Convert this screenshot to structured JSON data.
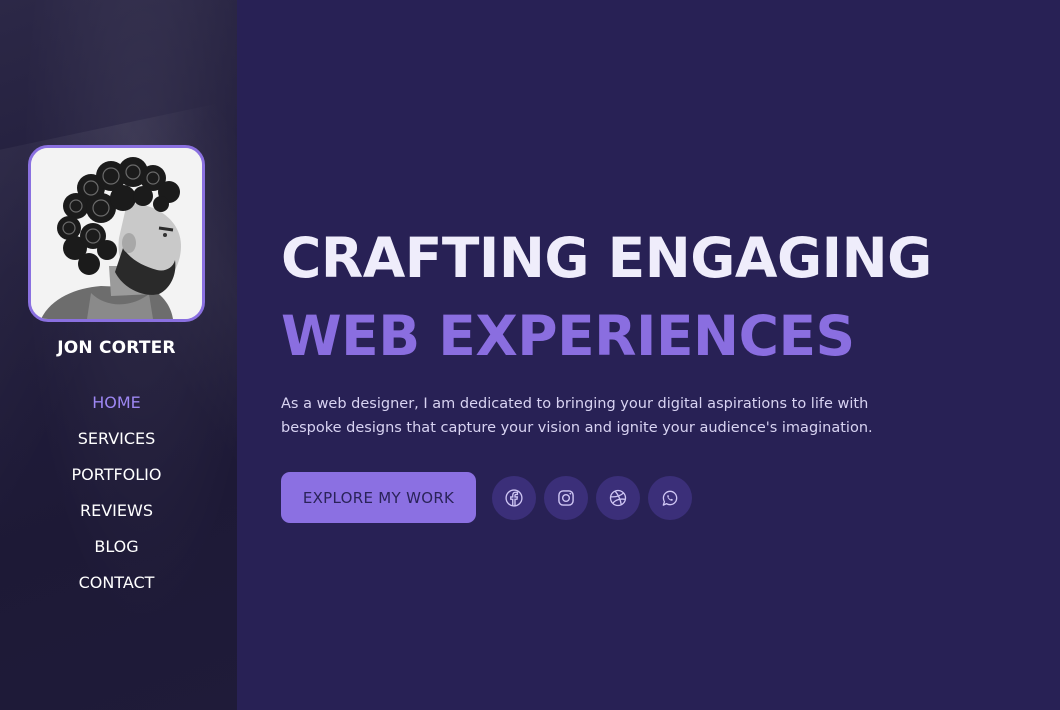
{
  "profile": {
    "name": "JON CORTER"
  },
  "nav": {
    "items": [
      {
        "label": "HOME",
        "active": true
      },
      {
        "label": "SERVICES",
        "active": false
      },
      {
        "label": "PORTFOLIO",
        "active": false
      },
      {
        "label": "REVIEWS",
        "active": false
      },
      {
        "label": "BLOG",
        "active": false
      },
      {
        "label": "CONTACT",
        "active": false
      }
    ]
  },
  "hero": {
    "headline_line1": "CRAFTING ENGAGING",
    "headline_line2": "WEB EXPERIENCES",
    "intro": "As a web designer, I am dedicated to bringing your digital aspirations to life with bespoke designs that capture your vision and ignite your audience's imagination.",
    "cta_label": "EXPLORE MY WORK"
  },
  "socials": [
    {
      "icon": "facebook-icon"
    },
    {
      "icon": "instagram-icon"
    },
    {
      "icon": "dribbble-icon"
    },
    {
      "icon": "whatsapp-icon"
    }
  ],
  "colors": {
    "background": "#282155",
    "accent": "#8b70e2",
    "sidebar": "#1f1b39",
    "social_bg": "#3b2f79"
  }
}
